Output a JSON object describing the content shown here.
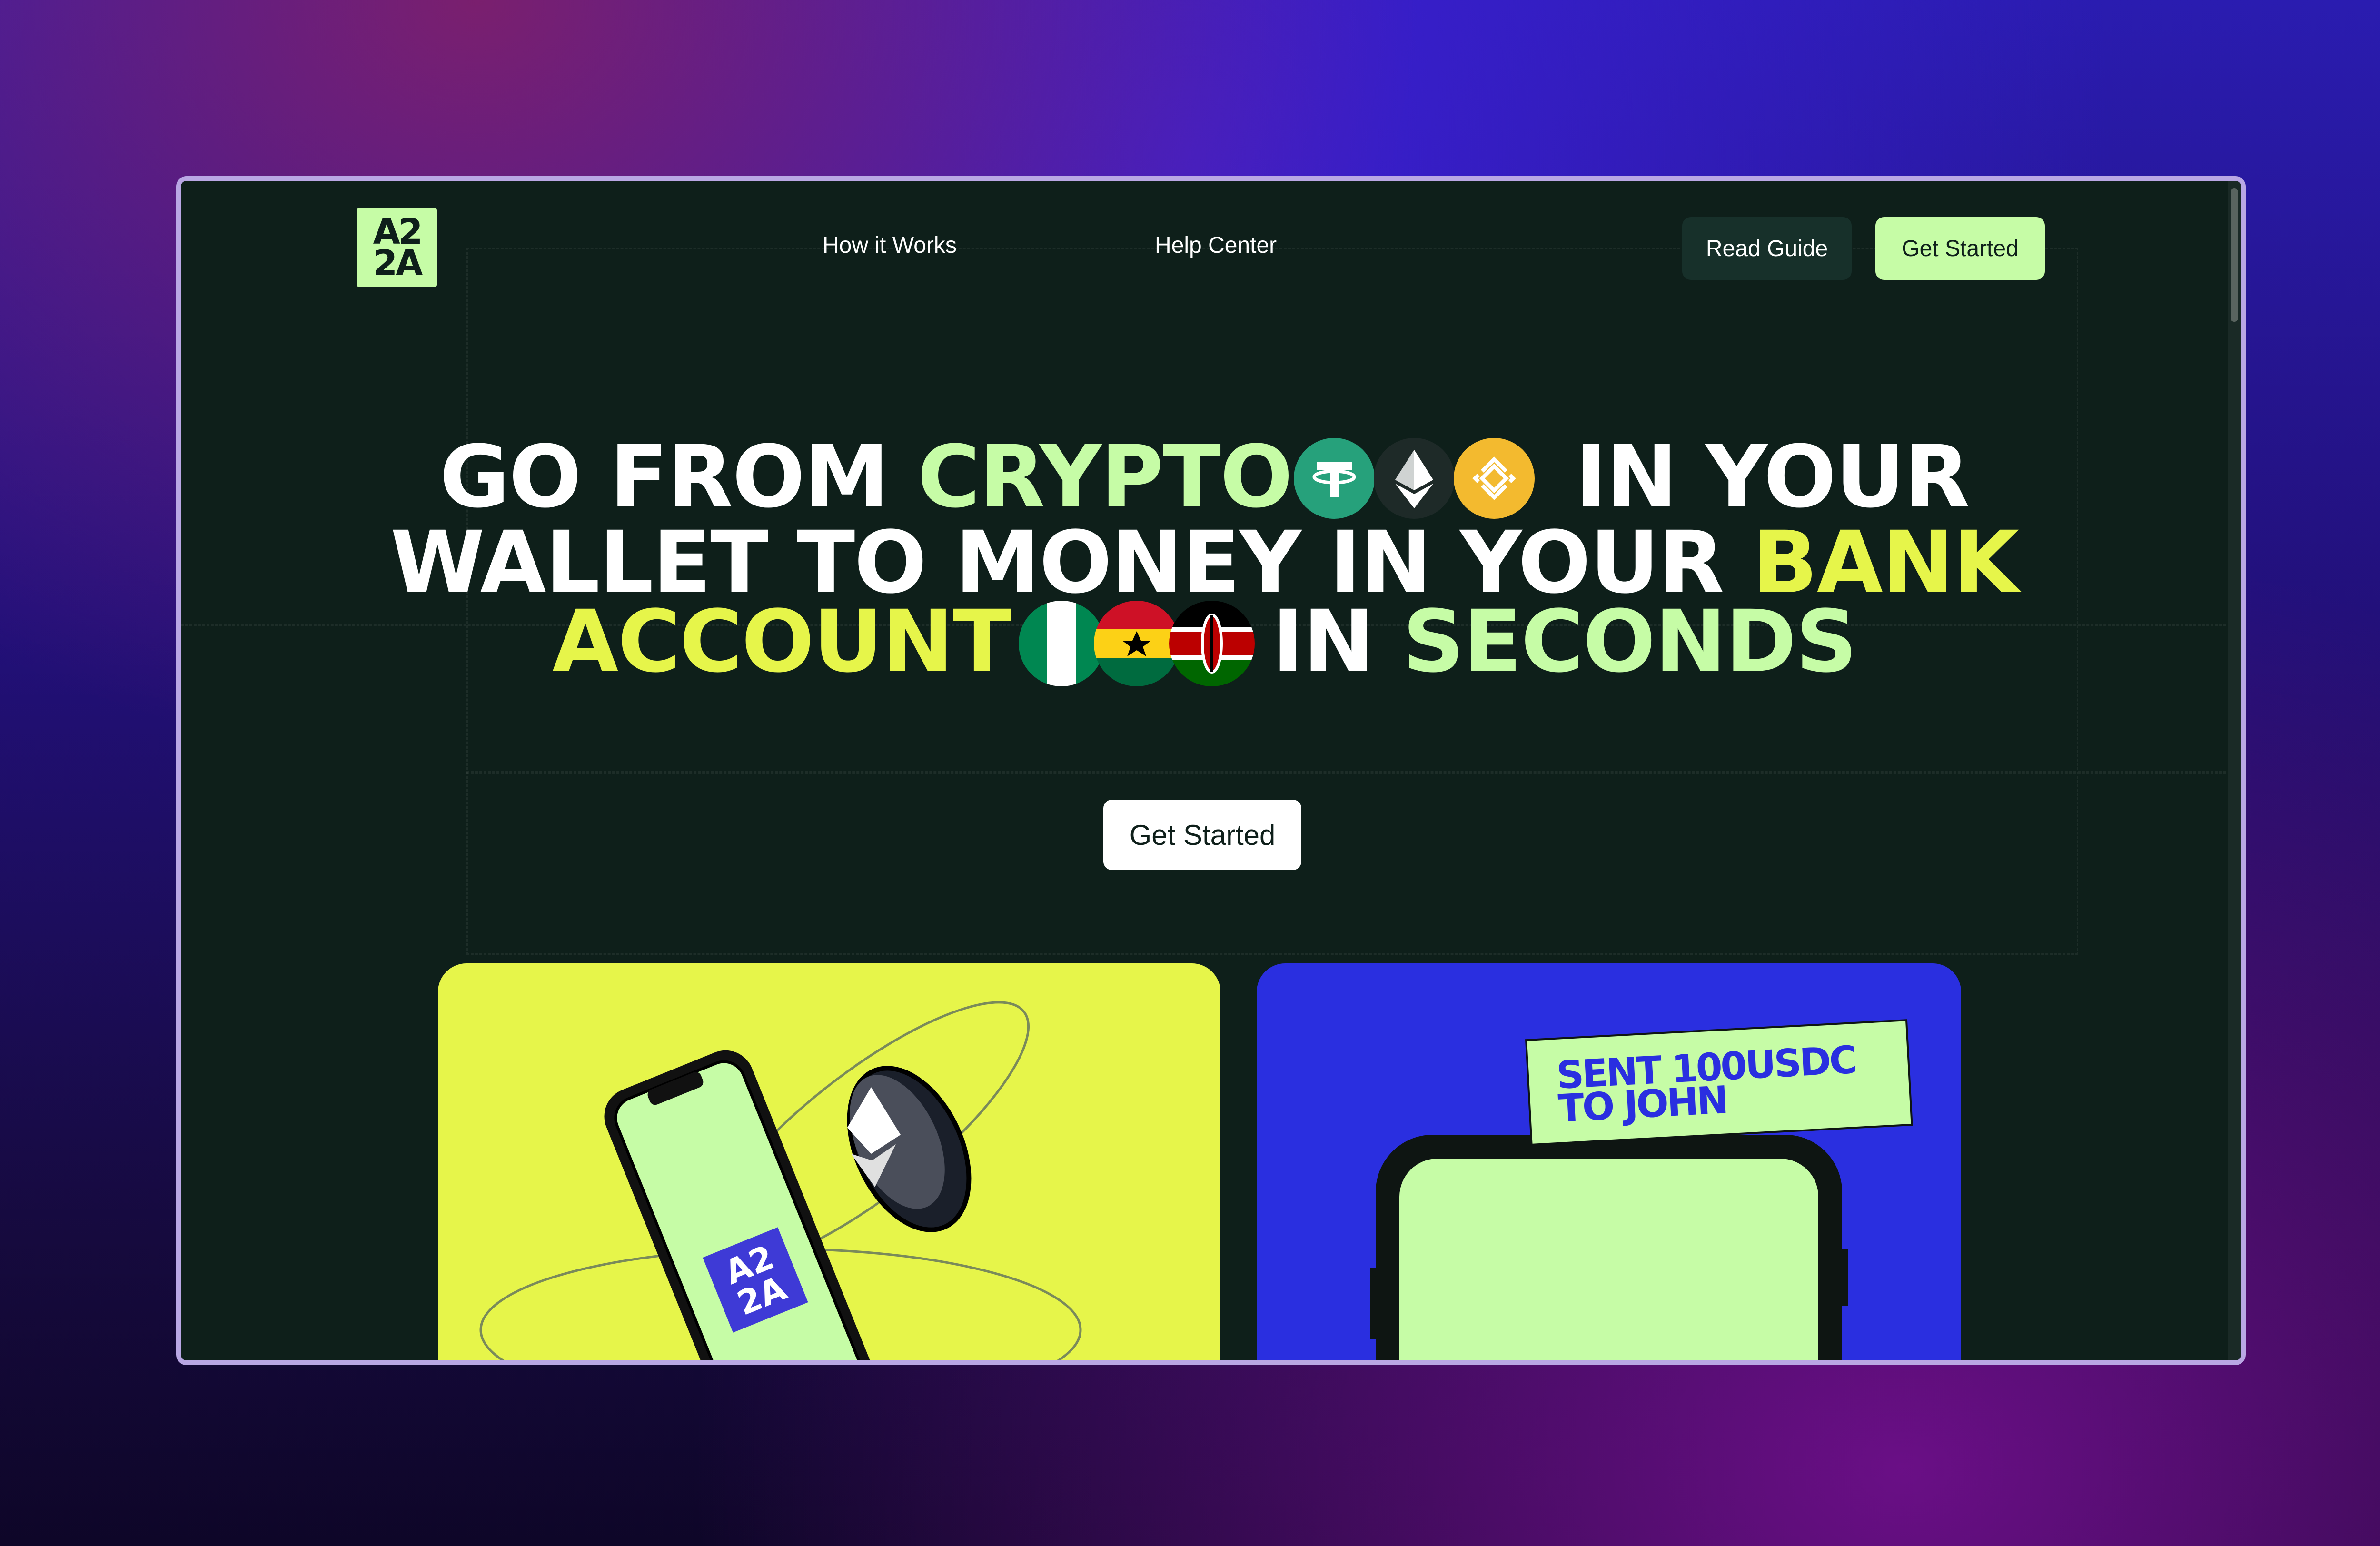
{
  "logo": {
    "line1": "A2",
    "line2": "2A"
  },
  "nav": {
    "links": [
      {
        "label": "How it Works"
      },
      {
        "label": "Help Center"
      }
    ],
    "read_guide_label": "Read Guide",
    "get_started_label": "Get Started"
  },
  "hero": {
    "line1": {
      "w1": "GO FROM",
      "w2": "CRYPTO",
      "w3": "IN YOUR"
    },
    "line2": {
      "w1": "WALLET TO MONEY IN YOUR",
      "w2": "BANK"
    },
    "line3": {
      "w1": "ACCOUNT",
      "w2": "IN",
      "w3": "SECONDS"
    },
    "crypto_icons": [
      "tether-icon",
      "ethereum-icon",
      "bnb-icon"
    ],
    "flags": [
      "nigeria-flag",
      "ghana-flag",
      "kenya-flag"
    ],
    "cta_label": "Get Started"
  },
  "cards": {
    "yellow": {
      "phone_logo_line1": "A2",
      "phone_logo_line2": "2A"
    },
    "blue": {
      "banner_line1": "SENT 100USDC",
      "banner_line2": "TO JOHN"
    }
  },
  "colors": {
    "page_bg": "#0e1f1a",
    "accent_green": "#c6fca6",
    "accent_yellow": "#e6f54a",
    "card_blue": "#2a2fe0",
    "tether": "#26a17b",
    "bnb": "#f3ba2f"
  }
}
